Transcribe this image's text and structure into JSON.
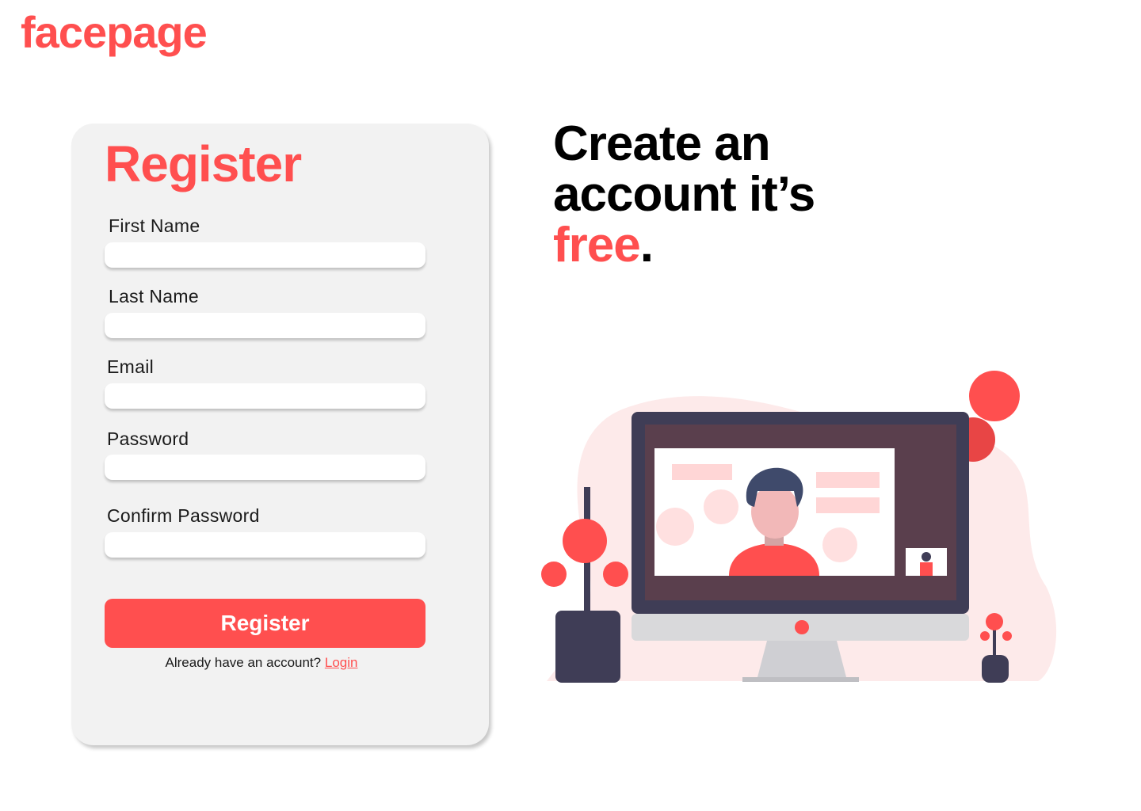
{
  "brand": {
    "logo": "facepage"
  },
  "form": {
    "title": "Register",
    "fields": [
      {
        "label": "First Name",
        "value": "",
        "placeholder": ""
      },
      {
        "label": "Last Name",
        "value": "",
        "placeholder": ""
      },
      {
        "label": "Email",
        "value": "",
        "placeholder": ""
      },
      {
        "label": "Password",
        "value": "",
        "placeholder": ""
      },
      {
        "label": "Confirm Password",
        "value": "",
        "placeholder": ""
      }
    ],
    "submit_label": "Register",
    "login_prompt": "Already have an account?",
    "login_link": "Login"
  },
  "hero": {
    "line1": "Create an",
    "line2": "account it’s",
    "accent": "free",
    "period": "."
  },
  "colors": {
    "accent": "#ff4f4f",
    "card_bg": "#f2f2f2",
    "text": "#000000"
  }
}
